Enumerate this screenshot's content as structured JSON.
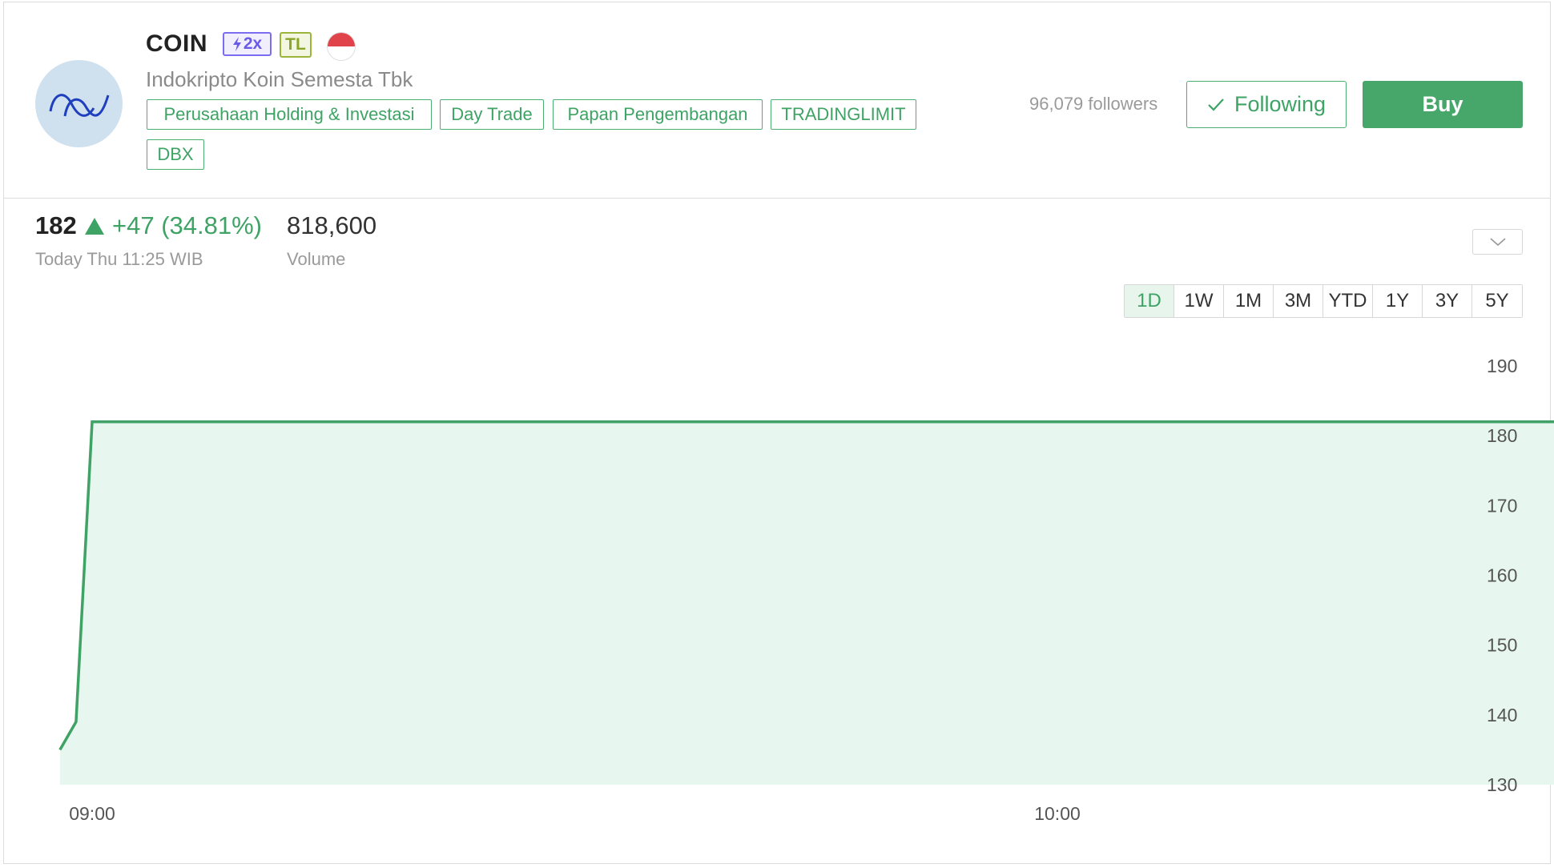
{
  "header": {
    "ticker": "COIN",
    "badge_multiplier": "2x",
    "badge_tl": "TL",
    "company_name": "Indokripto Koin Semesta Tbk",
    "tags": [
      "Perusahaan Holding & Investasi",
      "Day Trade",
      "Papan Pengembangan",
      "TRADINGLIMIT",
      "DBX"
    ],
    "followers": "96,079 followers",
    "following_label": "Following",
    "buy_label": "Buy"
  },
  "stats": {
    "price": "182",
    "change": "+47 (34.81%)",
    "time_label": "Today Thu 11:25 WIB",
    "volume": "818,600",
    "volume_label": "Volume"
  },
  "ranges": {
    "items": [
      "1D",
      "1W",
      "1M",
      "3M",
      "YTD",
      "1Y",
      "3Y",
      "5Y"
    ],
    "selected": "1D"
  },
  "colors": {
    "accent": "#3ea364",
    "area_fill": "#e8f6f0",
    "badge_2x": "#7b6cf0",
    "badge_tl": "#9ab53a"
  },
  "chart_data": {
    "type": "area",
    "x": [
      "08:58",
      "08:59",
      "09:00",
      "11:25"
    ],
    "y": [
      135,
      139,
      182,
      182
    ],
    "x_ticks": [
      "09:00",
      "10:00"
    ],
    "y_ticks": [
      190,
      180,
      170,
      160,
      150,
      140,
      130
    ],
    "ylim": [
      130,
      190
    ],
    "grid": false,
    "line_color": "#3ea364"
  }
}
